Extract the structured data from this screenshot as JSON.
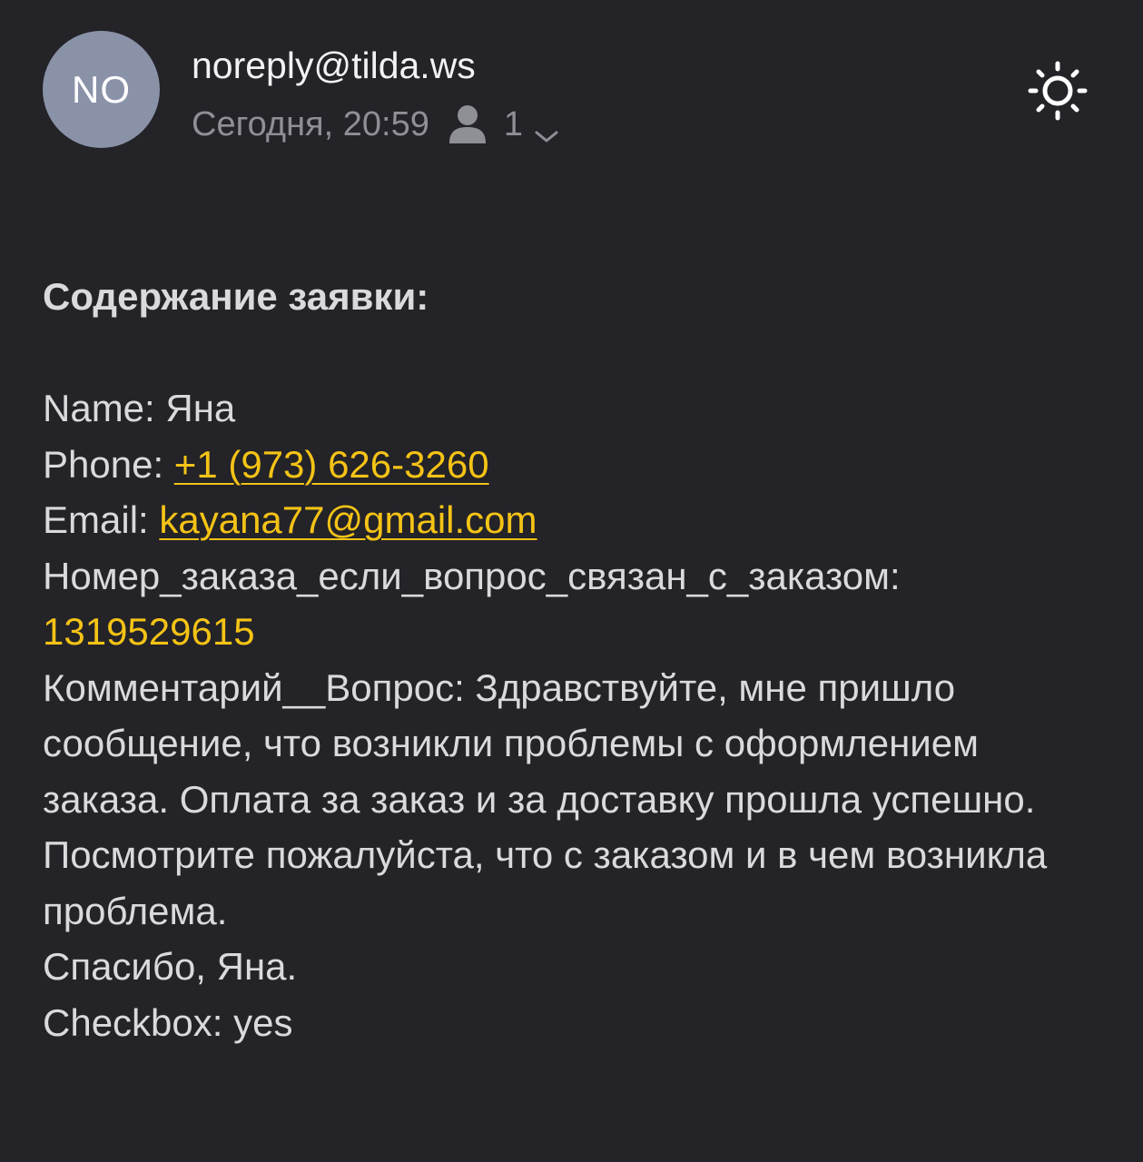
{
  "header": {
    "avatar_initials": "NO",
    "sender": "noreply@tilda.ws",
    "date": "Сегодня, 20:59",
    "recipients_icon": "person-icon",
    "recipients_count": "1",
    "expand_icon": "chevron-down-icon",
    "theme_icon": "sun-icon"
  },
  "body": {
    "heading": "Содержание заявки:",
    "name_label": "Name: ",
    "name_value": "Яна",
    "phone_label": "Phone: ",
    "phone_value": "+1 (973) 626-3260",
    "email_label": "Email: ",
    "email_value": "kayana77@gmail.com",
    "order_label": "Номер_заказа_если_вопрос_связан_с_заказом:",
    "order_value": "1319529615",
    "comment_label": "Комментарий__Вопрос: ",
    "comment_text": "Здравствуйте, мне пришло сообщение, что возникли проблемы с оформлением заказа. Оплата за заказ и за доставку прошла успешно. Посмотрите пожалуйста, что с заказом и в чем возникла проблема.",
    "signoff": "Спасибо, Яна.",
    "checkbox_label": "Checkbox: ",
    "checkbox_value": "yes"
  },
  "colors": {
    "background": "#232328",
    "text": "#dadadd",
    "link": "#f5c316",
    "avatar": "#8a92a8",
    "meta": "#8f8f96"
  }
}
